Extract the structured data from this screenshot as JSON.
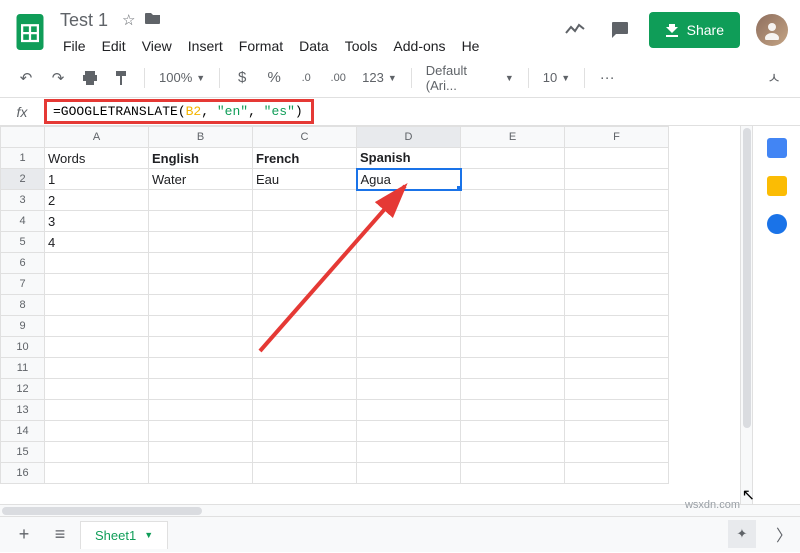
{
  "doc": {
    "title": "Test 1"
  },
  "menu": {
    "file": "File",
    "edit": "Edit",
    "view": "View",
    "insert": "Insert",
    "format": "Format",
    "data": "Data",
    "tools": "Tools",
    "addons": "Add-ons",
    "help": "He"
  },
  "share": {
    "label": "Share"
  },
  "toolbar": {
    "zoom": "100%",
    "currency": "$",
    "percent": "%",
    "dec_dec": ".0",
    "dec_inc": ".00",
    "numformat": "123",
    "font": "Default (Ari...",
    "fontsize": "10",
    "more": "···"
  },
  "formula": {
    "prefix": "=GOOGLETRANSLATE(",
    "ref": "B2",
    "sep1": ", ",
    "arg1": "\"en\"",
    "sep2": ", ",
    "arg2": "\"es\"",
    "suffix": ")"
  },
  "columns": [
    "A",
    "B",
    "C",
    "D",
    "E",
    "F"
  ],
  "rows": [
    "1",
    "2",
    "3",
    "4",
    "5",
    "6",
    "7",
    "8",
    "9",
    "10",
    "11",
    "12",
    "13",
    "14",
    "15",
    "16"
  ],
  "cells": {
    "A1": "Words",
    "B1": "English",
    "C1": "French",
    "D1": "Spanish",
    "A2": "1",
    "B2": "Water",
    "C2": "Eau",
    "D2": "Agua",
    "A3": "2",
    "A4": "3",
    "A5": "4"
  },
  "tabs": {
    "sheet1": "Sheet1"
  },
  "watermark": "wsxdn.com"
}
